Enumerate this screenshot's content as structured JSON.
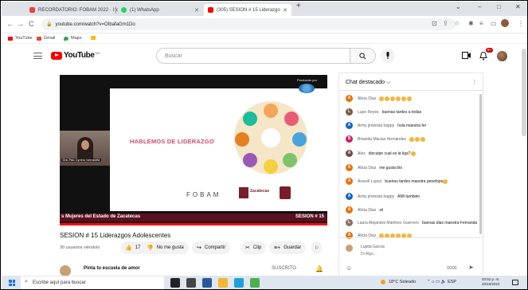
{
  "browser": {
    "tabs": [
      {
        "label": "RECORDATORIO: FOBAM 2022 · I",
        "favicon_color": "#ea4335",
        "active": false
      },
      {
        "label": "(1) WhatsApp",
        "favicon_color": "#25d366",
        "active": false
      },
      {
        "label": "(305) SESION # 15 Liderazgo",
        "favicon_color": "#ff0000",
        "active": true
      }
    ],
    "new_tab": "+",
    "window_controls": {
      "minimize": "–",
      "maximize": "□",
      "close": "✕"
    },
    "nav": {
      "back": "←",
      "forward": "→",
      "reload": "C",
      "home": "⌂"
    },
    "url": "youtube.com/watch?v=OIbafaGm1Do",
    "bookmarks": [
      {
        "label": "YouTube",
        "color": "#ff0000"
      },
      {
        "label": "Gmail",
        "color": "#ea4335"
      },
      {
        "label": "Maps",
        "color": "#34a853"
      },
      {
        "label": "",
        "color": "#fbbc04"
      }
    ]
  },
  "youtube": {
    "logo_text": "YouTube",
    "logo_country": "MX",
    "search_placeholder": "Buscar",
    "notification_count": "9+"
  },
  "player": {
    "slide_title": "HABLEMOS DE LIDERAZGO",
    "slide_brand": "FOBAM",
    "slide_partner": "Zacatecas",
    "produced_by": "Producido por",
    "webcam_caption": "Dra. Psic. Cynthia Valenzuela",
    "ticker_left": "s Mujeres del Estado de Zacatecas",
    "ticker_right": "SESION # 15",
    "accent_color": "#ff0000",
    "ticker_color": "#5a1020"
  },
  "video": {
    "title": "SESION # 15 Liderazgos Adolescentes",
    "viewers": "30 usuarios viéndolo",
    "like_count": "17",
    "dislike_label": "No me gusta",
    "share_label": "Compartir",
    "clip_label": "Clip",
    "save_label": "Guardar",
    "channel_name": "Pinta tu escuela de amor",
    "subscribe_label": "SUSCRITO"
  },
  "chat": {
    "title": "Chat destacado ⌵",
    "messages": [
      {
        "author": "Alicia Diaz",
        "text": "",
        "emoji": 6,
        "initial": "A",
        "color": "#e8710a"
      },
      {
        "author": "Lupe Reyes",
        "text": "buenas tardes a todas",
        "emoji": 0,
        "initial": "L",
        "color": "#7b5a44"
      },
      {
        "author": "Army jiminista happy",
        "text": "hola maestra fer",
        "emoji": 0,
        "initial": "A",
        "color": "#1565c0"
      },
      {
        "author": "Briseida Macias Hernandez",
        "text": "",
        "emoji": 3,
        "initial": "B",
        "color": "#d81b60"
      },
      {
        "author": "Alex",
        "text": "disculpe cual es la liga?",
        "emoji": 1,
        "initial": "A",
        "color": "#6d4c41"
      },
      {
        "author": "Alicia Diaz",
        "text": "me gusta btx",
        "emoji": 0,
        "initial": "A",
        "color": "#e8710a"
      },
      {
        "author": "Araceli Lopez",
        "text": "buenas tardes maestra penelope",
        "emoji": 1,
        "initial": "A",
        "color": "#e8710a"
      },
      {
        "author": "Army jiminista happy",
        "text": "AMI también",
        "emoji": 0,
        "initial": "A",
        "color": "#1565c0"
      },
      {
        "author": "Alicia Diaz",
        "text": "sii",
        "emoji": 0,
        "initial": "A",
        "color": "#e8710a"
      },
      {
        "author": "Laura Alejandra Martinez Guerrero",
        "text": "buenas dias maestra Fernanda",
        "emoji": 0,
        "initial": "L",
        "color": "#8d6e63"
      },
      {
        "author": "Alicia Diaz",
        "text": "",
        "emoji": 6,
        "initial": "A",
        "color": "#e8710a"
      }
    ],
    "me_name": "Lupita Garcia",
    "input_placeholder": "Di Algo...",
    "char_counter": "0/200",
    "send": "➤"
  },
  "taskbar": {
    "search_placeholder": "Escribe aquí para buscar",
    "apps": [
      {
        "name": "task-view-icon",
        "color": "#222222"
      },
      {
        "name": "widgets-icon",
        "color": "#444444"
      },
      {
        "name": "word-icon",
        "color": "#2b579a"
      },
      {
        "name": "explorer-icon",
        "color": "#f3b731"
      },
      {
        "name": "edge-icon",
        "color": "#1fa0d8"
      },
      {
        "name": "chrome-icon",
        "color": "#4caf50"
      }
    ],
    "weather": "18°C Soleado",
    "tray": "⌃ ⌂ ▭ 🔈 ESP",
    "time": "03:52 p. m.",
    "date": "20/10/2022"
  }
}
